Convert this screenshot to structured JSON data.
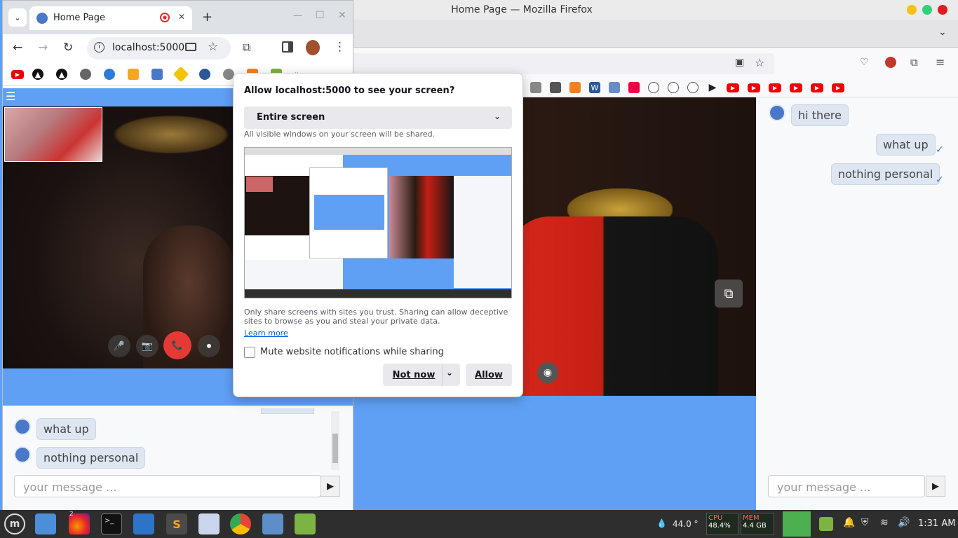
{
  "firefox": {
    "title": "Home Page — Mozilla Firefox",
    "window_buttons": [
      "minimize",
      "maximize",
      "close"
    ],
    "video_button_label": "picture-in-picture",
    "chat": {
      "messages": [
        {
          "text": "hi there",
          "side": "left"
        },
        {
          "text": "what up",
          "side": "right",
          "status": "✓"
        },
        {
          "text": "nothing personal",
          "side": "right",
          "status": "✓"
        }
      ],
      "input_placeholder": "your message ...",
      "send_icon": "▶"
    }
  },
  "chrome": {
    "tab_title": "Home Page",
    "new_tab": "+",
    "tab_close": "✕",
    "url": "localhost:5000",
    "menu_icon": "☰",
    "more_bookmarks": "»",
    "controls": {
      "mic": "🎤",
      "camera": "📷",
      "hangup": "📞",
      "share": "⏺"
    },
    "chat": {
      "messages": [
        {
          "text": "what up",
          "side": "left"
        },
        {
          "text": "nothing personal",
          "side": "left"
        }
      ],
      "input_placeholder": "your message ...",
      "send_icon": "▶"
    }
  },
  "dialog": {
    "title": "Allow localhost:5000 to see your screen?",
    "selected_source": "Entire screen",
    "select_hint": "All visible windows on your screen will be shared.",
    "warning": "Only share screens with sites you trust. Sharing can allow deceptive sites to browse as you and steal your private data.",
    "learn_more": "Learn more",
    "mute_label": "Mute website notifications while sharing",
    "mute_checked": false,
    "not_now_label": "Not now",
    "allow_label": "Allow"
  },
  "taskbar": {
    "firefox_badge": "2",
    "temperature": "44.0 °",
    "cpu_label": "CPU",
    "cpu_value": "48.4%",
    "mem_label": "MEM",
    "mem_value": "4.4 GB",
    "clock": "1:31 AM"
  },
  "colors": {
    "page_blue": "#5fa0f5",
    "hangup_red": "#e53935",
    "link_blue": "#0060df"
  }
}
